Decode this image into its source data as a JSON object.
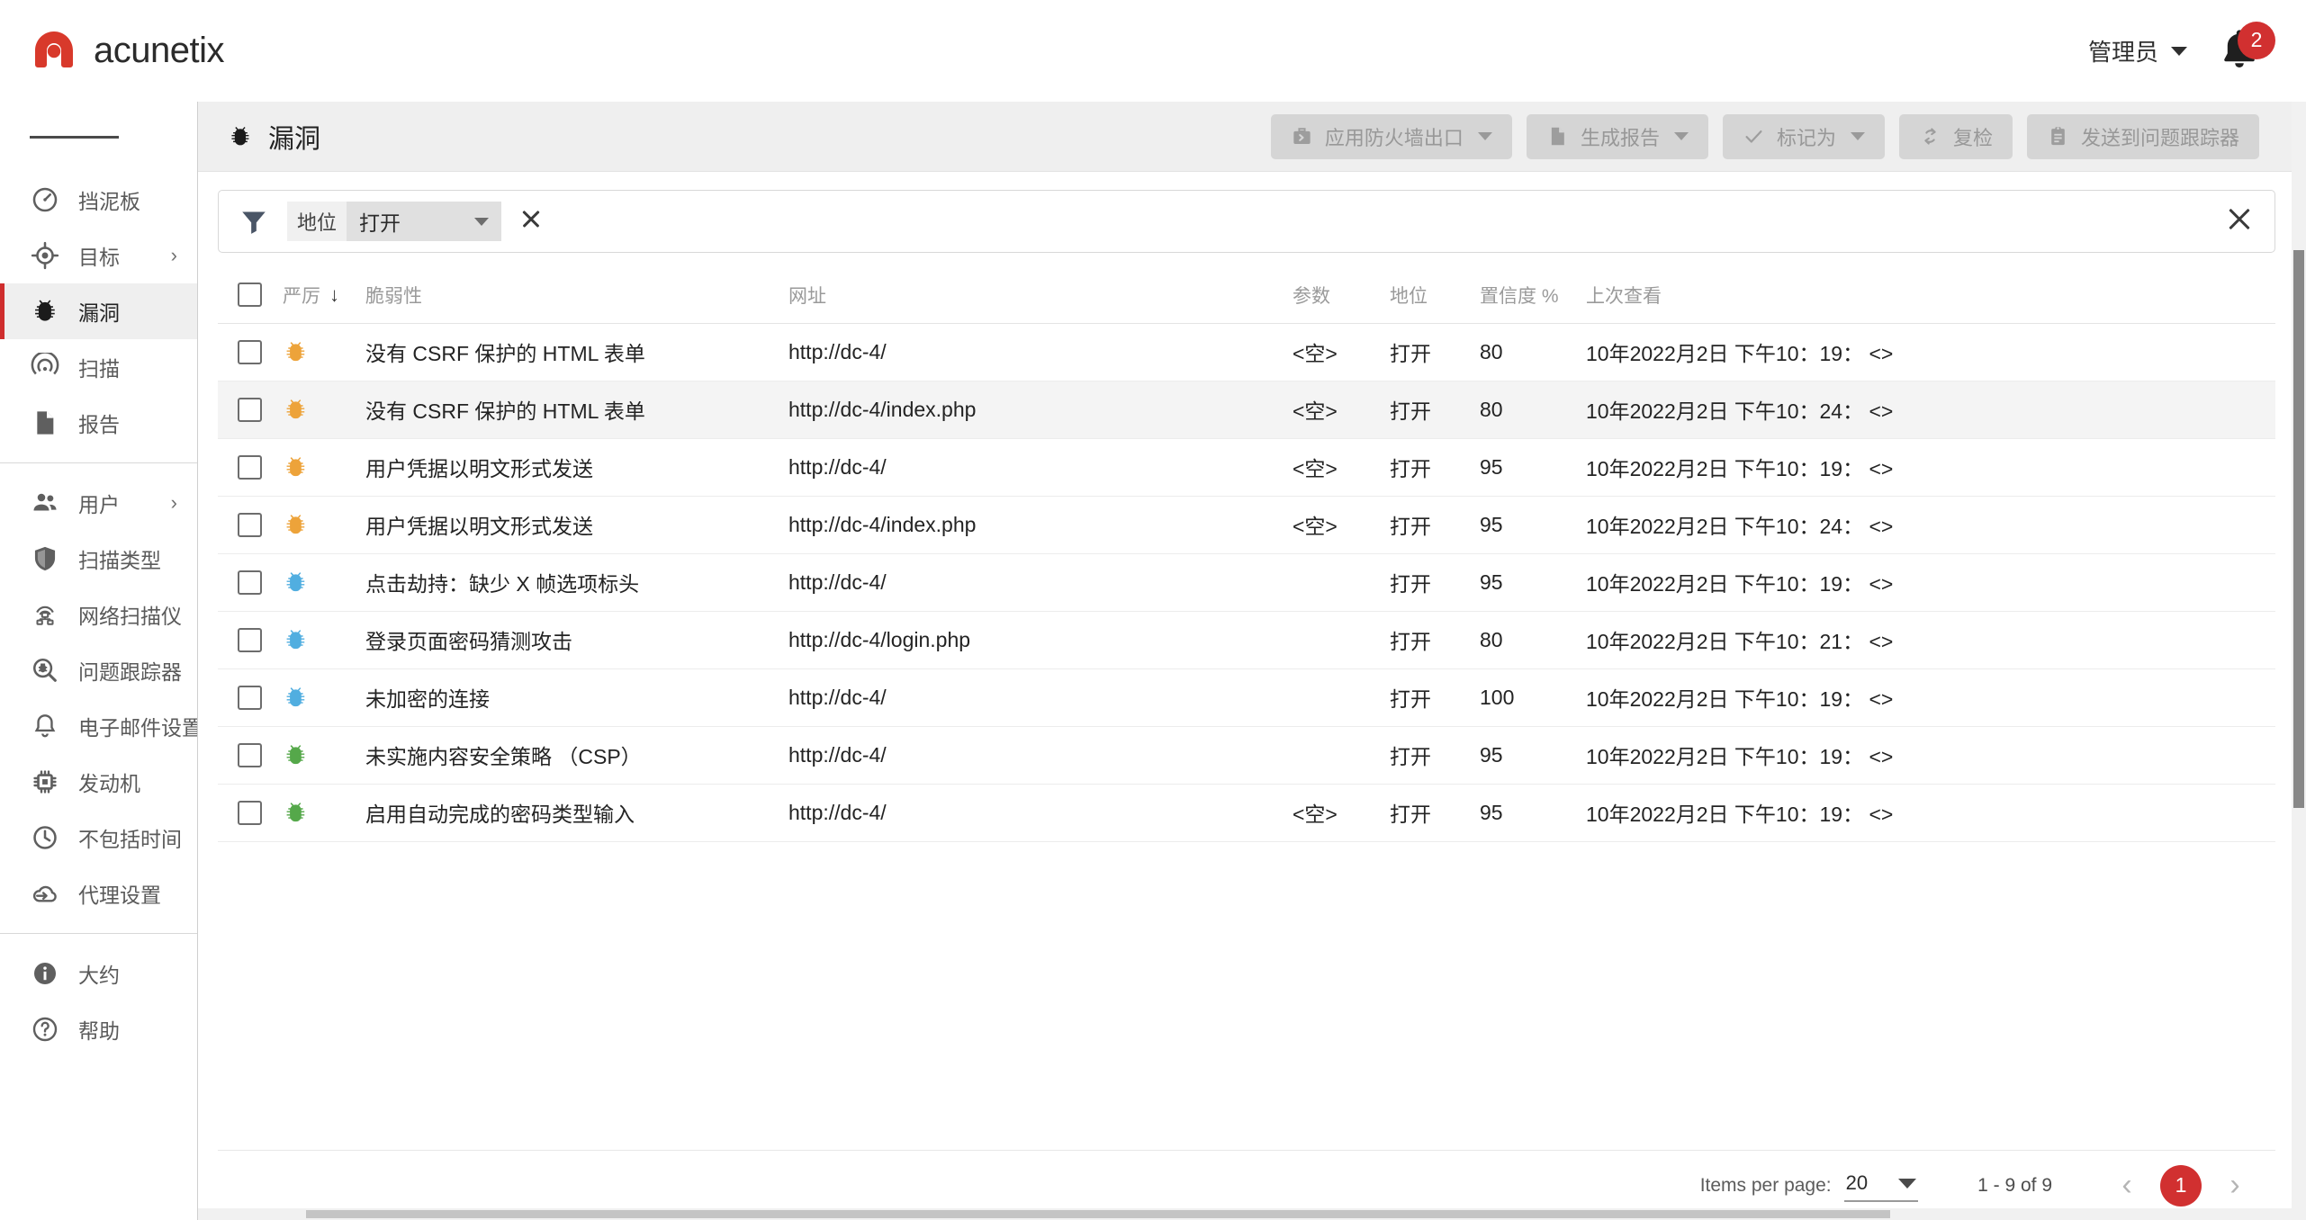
{
  "brand": {
    "name": "acunetix",
    "accent": "#d8392b"
  },
  "topbar": {
    "user_label": "管理员",
    "notifications_count": "2"
  },
  "sidebar": {
    "groups": [
      {
        "items": [
          {
            "label": "挡泥板",
            "icon": "gauge-icon",
            "active": false,
            "chevron": ""
          },
          {
            "label": "目标",
            "icon": "target-icon",
            "active": false,
            "chevron": "›"
          },
          {
            "label": "漏洞",
            "icon": "bug-icon",
            "active": true,
            "chevron": ""
          },
          {
            "label": "扫描",
            "icon": "scan-icon",
            "active": false,
            "chevron": ""
          },
          {
            "label": "报告",
            "icon": "document-icon",
            "active": false,
            "chevron": ""
          }
        ]
      },
      {
        "items": [
          {
            "label": "用户",
            "icon": "users-icon",
            "active": false,
            "chevron": "›"
          },
          {
            "label": "扫描类型",
            "icon": "shield-icon",
            "active": false,
            "chevron": ""
          },
          {
            "label": "网络扫描仪",
            "icon": "network-scanner-icon",
            "active": false,
            "chevron": ""
          },
          {
            "label": "问题跟踪器",
            "icon": "issue-tracker-icon",
            "active": false,
            "chevron": ""
          },
          {
            "label": "电子邮件设置",
            "icon": "bell-icon",
            "active": false,
            "chevron": ""
          },
          {
            "label": "发动机",
            "icon": "chip-icon",
            "active": false,
            "chevron": ""
          },
          {
            "label": "不包括时间",
            "icon": "clock-icon",
            "active": false,
            "chevron": ""
          },
          {
            "label": "代理设置",
            "icon": "cloud-proxy-icon",
            "active": false,
            "chevron": ""
          }
        ]
      },
      {
        "items": [
          {
            "label": "大约",
            "icon": "info-icon",
            "active": false,
            "chevron": ""
          },
          {
            "label": "帮助",
            "icon": "help-icon",
            "active": false,
            "chevron": ""
          }
        ]
      }
    ]
  },
  "page": {
    "title": "漏洞",
    "actions": [
      {
        "label": "应用防火墙出口",
        "icon": "export-firewall-icon",
        "has_caret": true,
        "disabled": true
      },
      {
        "label": "生成报告",
        "icon": "document-icon",
        "has_caret": true,
        "disabled": true
      },
      {
        "label": "标记为",
        "icon": "check-icon",
        "has_caret": true,
        "disabled": true
      },
      {
        "label": "复检",
        "icon": "recheck-icon",
        "has_caret": false,
        "disabled": true
      },
      {
        "label": "发送到问题跟踪器",
        "icon": "clipboard-icon",
        "has_caret": false,
        "disabled": true
      }
    ]
  },
  "filter": {
    "key": "地位",
    "value": "打开",
    "remove_icon": "close-icon",
    "clear_icon": "close-icon",
    "funnel_icon": "funnel-icon"
  },
  "table": {
    "headers": {
      "select_all": "",
      "severity": "严厉",
      "severity_sort": "↓",
      "vulnerability": "脆弱性",
      "url": "网址",
      "parameter": "参数",
      "status": "地位",
      "confidence": "置信度 %",
      "last_seen": "上次查看"
    },
    "rows": [
      {
        "severity": "medium",
        "name": "没有 CSRF 保护的 HTML 表单",
        "url": "http://dc-4/",
        "parameter": "<空>",
        "status": "打开",
        "confidence": "80",
        "last_seen": "10年2022月2日 下午10：19： <>",
        "alt": false
      },
      {
        "severity": "medium",
        "name": "没有 CSRF 保护的 HTML 表单",
        "url": "http://dc-4/index.php",
        "parameter": "<空>",
        "status": "打开",
        "confidence": "80",
        "last_seen": "10年2022月2日 下午10：24： <>",
        "alt": true
      },
      {
        "severity": "medium",
        "name": "用户凭据以明文形式发送",
        "url": "http://dc-4/",
        "parameter": "<空>",
        "status": "打开",
        "confidence": "95",
        "last_seen": "10年2022月2日 下午10：19： <>",
        "alt": false
      },
      {
        "severity": "medium",
        "name": "用户凭据以明文形式发送",
        "url": "http://dc-4/index.php",
        "parameter": "<空>",
        "status": "打开",
        "confidence": "95",
        "last_seen": "10年2022月2日 下午10：24： <>",
        "alt": false
      },
      {
        "severity": "low",
        "name": "点击劫持：缺少 X 帧选项标头",
        "url": "http://dc-4/",
        "parameter": "",
        "status": "打开",
        "confidence": "95",
        "last_seen": "10年2022月2日 下午10：19： <>",
        "alt": false
      },
      {
        "severity": "low",
        "name": "登录页面密码猜测攻击",
        "url": "http://dc-4/login.php",
        "parameter": "",
        "status": "打开",
        "confidence": "80",
        "last_seen": "10年2022月2日 下午10：21： <>",
        "alt": false
      },
      {
        "severity": "low",
        "name": "未加密的连接",
        "url": "http://dc-4/",
        "parameter": "",
        "status": "打开",
        "confidence": "100",
        "last_seen": "10年2022月2日 下午10：19： <>",
        "alt": false
      },
      {
        "severity": "info",
        "name": "未实施内容安全策略 （CSP）",
        "url": "http://dc-4/",
        "parameter": "",
        "status": "打开",
        "confidence": "95",
        "last_seen": "10年2022月2日 下午10：19： <>",
        "alt": false
      },
      {
        "severity": "info",
        "name": "启用自动完成的密码类型输入",
        "url": "http://dc-4/",
        "parameter": "<空>",
        "status": "打开",
        "confidence": "95",
        "last_seen": "10年2022月2日 下午10：19： <>",
        "alt": false
      }
    ]
  },
  "pagination": {
    "items_per_page_label": "Items per page:",
    "items_per_page_value": "20",
    "range": "1 - 9 of 9",
    "prev_icon": "chevron-left-icon",
    "next_icon": "chevron-right-icon",
    "current_page": "1"
  },
  "severity_colors": {
    "medium": "#eda33a",
    "low": "#51aee0",
    "info": "#55a84a",
    "high": "#d8392b"
  }
}
